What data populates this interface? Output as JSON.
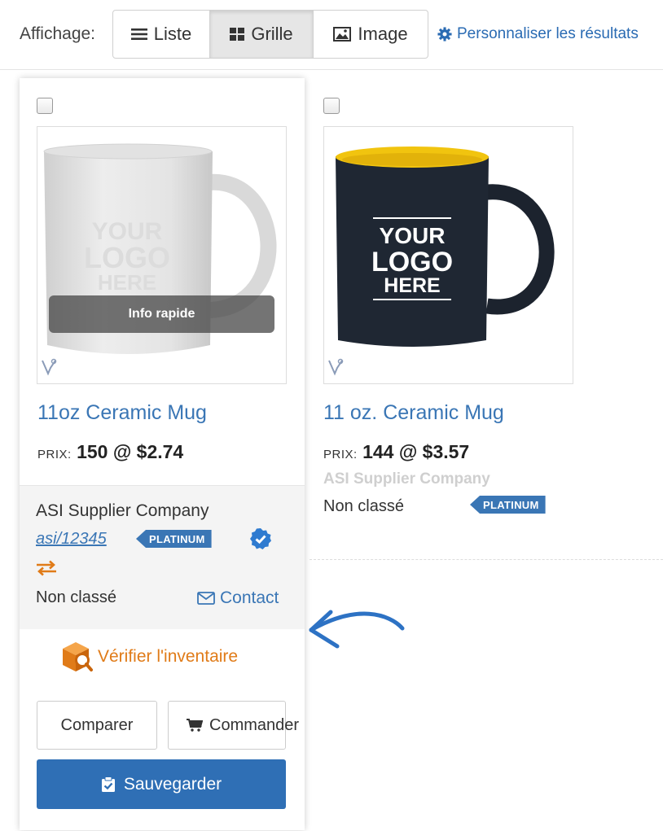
{
  "toolbar": {
    "view_label": "Affichage:",
    "views": [
      {
        "label": "Liste",
        "icon": "list-icon",
        "active": false
      },
      {
        "label": "Grille",
        "icon": "grid-icon",
        "active": true
      },
      {
        "label": "Image",
        "icon": "image-icon",
        "active": false
      }
    ],
    "customize_label": "Personnaliser les résultats",
    "customize_icon": "gear-icon"
  },
  "products": [
    {
      "title": "11oz Ceramic Mug",
      "price_label": "PRIX:",
      "price_value": "150 @ $2.74",
      "quick_info": "Info rapide",
      "mug_logo": [
        "YOUR",
        "LOGO",
        "HERE"
      ],
      "supplier": "ASI Supplier Company",
      "asi": "asi/12345",
      "badge": "PLATINUM",
      "rating": "Non classé",
      "contact": "Contact",
      "inventory": "Vérifier l'inventaire",
      "compare": "Comparer",
      "order": "Commander",
      "save": "Sauvegarder"
    },
    {
      "title": "11 oz. Ceramic Mug",
      "price_label": "PRIX:",
      "price_value": "144 @ $3.57",
      "mug_logo": [
        "YOUR",
        "LOGO",
        "HERE"
      ],
      "supplier": "ASI Supplier Company",
      "rating": "Non classé",
      "badge": "PLATINUM"
    }
  ],
  "colors": {
    "link_blue": "#3a76b5",
    "save_button": "#2f6fb5",
    "inventory_orange": "#e07b18",
    "mug_inner_yellow": "#f1c40f",
    "mug_black": "#1f2733",
    "annotation_arrow": "#2d72c4"
  }
}
